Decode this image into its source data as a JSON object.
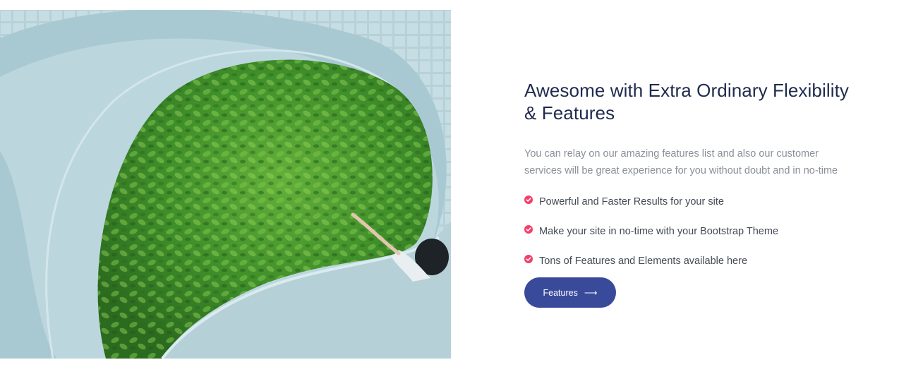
{
  "section": {
    "title": "Awesome with Extra Ordinary Flexibility & Features",
    "description": "You can relay on our amazing features list and also our customer services will be great experience for you without doubt and in no-time",
    "features": [
      {
        "icon": "check-circle-icon",
        "label": "Powerful and Faster Results for your site"
      },
      {
        "icon": "check-circle-icon",
        "label": "Make your site in no-time with your Bootstrap Theme"
      },
      {
        "icon": "check-circle-icon",
        "label": "Tons of Features and Elements available here"
      }
    ],
    "button": {
      "label": "Features",
      "icon": "arrow-right-icon"
    }
  },
  "colors": {
    "heading": "#1f2a4d",
    "accent_check": "#f43f6b",
    "button": "#3a4a9b"
  },
  "image": {
    "subject": "aerial-spiral-staircase-with-green-plants"
  }
}
